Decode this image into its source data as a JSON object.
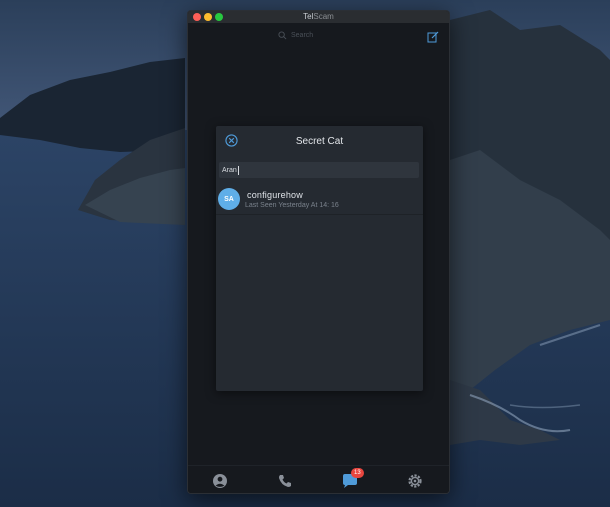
{
  "window": {
    "title": "Tel",
    "title_overlay": "Scam"
  },
  "header": {
    "search_placeholder": "Search",
    "search_icon": "search-icon",
    "compose_icon": "compose-icon"
  },
  "modal": {
    "title": "Secret Cat",
    "close_icon": "close-circle-icon",
    "search_value": "Aran"
  },
  "contacts": [
    {
      "initials": "SA",
      "name": "configurehow",
      "status": "Last Seen Yesterday At 14: 16",
      "avatar_color": "#5faee8"
    }
  ],
  "tabbar": {
    "items": [
      "contacts-tab",
      "calls-tab",
      "chats-tab",
      "settings-tab"
    ],
    "chats_badge": "13"
  },
  "colors": {
    "accent": "#4f9bd9",
    "badge": "#e8463f",
    "window_bg": "#16191e",
    "modal_bg": "#252a31"
  }
}
